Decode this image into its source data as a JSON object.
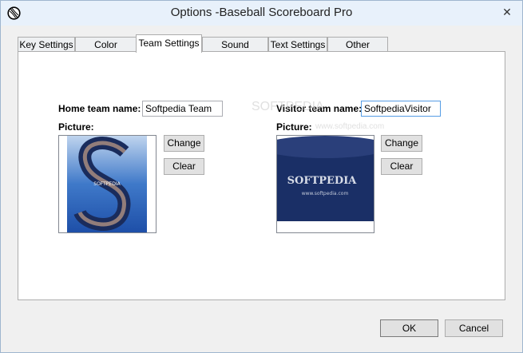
{
  "window": {
    "title": "Options -Baseball Scoreboard Pro",
    "close_glyph": "✕"
  },
  "tabs": [
    {
      "label": "Key Settings",
      "active": false
    },
    {
      "label": "Color Settings",
      "active": false
    },
    {
      "label": "Team Settings",
      "active": true
    },
    {
      "label": "Sound Settings",
      "active": false
    },
    {
      "label": "Text Settings",
      "active": false
    },
    {
      "label": "Other Settings",
      "active": false
    }
  ],
  "home": {
    "name_label": "Home team name:",
    "name_value": "Softpedia Team",
    "picture_label": "Picture:",
    "change_label": "Change",
    "clear_label": "Clear",
    "picture_text": "SOFTPEDIA"
  },
  "visitor": {
    "name_label": "Visitor team name:",
    "name_value": "SoftpediaVisitor",
    "picture_label": "Picture:",
    "change_label": "Change",
    "clear_label": "Clear",
    "picture_text": "SOFTPEDIA",
    "picture_url_text": "www.softpedia.com"
  },
  "watermark": {
    "line1": "SOFTPEDIA",
    "line2": "www.softpedia.com"
  },
  "footer": {
    "ok_label": "OK",
    "cancel_label": "Cancel"
  },
  "colors": {
    "titlebar_bg": "#e8f1fb",
    "focus_border": "#569de5",
    "home_image_bg": "#2b63b8",
    "visitor_image_bg": "#1a2f66"
  }
}
